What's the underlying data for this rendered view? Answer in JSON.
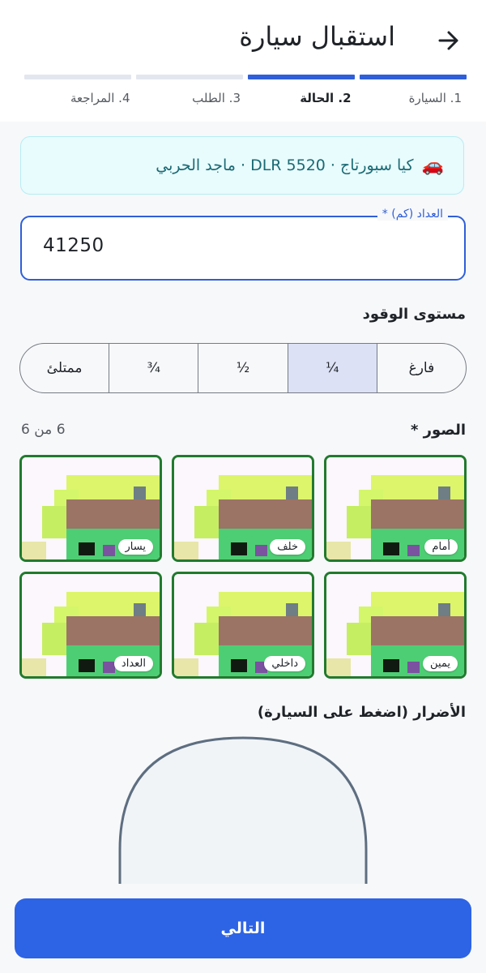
{
  "header": {
    "title": "استقبال سيارة",
    "back_icon": "arrow-right-icon"
  },
  "steps": [
    {
      "label": "1. السيارة",
      "state": "done",
      "color": "#2f5fd9"
    },
    {
      "label": "2. الحالة",
      "state": "current",
      "color": "#2f5fd9"
    },
    {
      "label": "3. الطلب",
      "state": "pending",
      "color": "#e3e6ee"
    },
    {
      "label": "4. المراجعة",
      "state": "pending",
      "color": "#e3e6ee"
    }
  ],
  "car_card": {
    "icon": "car-icon",
    "emoji": "🚗",
    "text": "كيا سبورتاج · DLR 5520 · ماجد الحربي"
  },
  "odometer": {
    "label": "العداد (كم) *",
    "value": "41250"
  },
  "fuel": {
    "label": "مستوى الوقود",
    "options": [
      "فارغ",
      "¼",
      "½",
      "¾",
      "ممتلئ"
    ],
    "selected": "¼"
  },
  "photos": {
    "label": "الصور *",
    "count": "6 من 6",
    "items": [
      {
        "tag": "أمام"
      },
      {
        "tag": "خلف"
      },
      {
        "tag": "يسار"
      },
      {
        "tag": "يمين"
      },
      {
        "tag": "داخلي"
      },
      {
        "tag": "العداد"
      }
    ]
  },
  "damage": {
    "label": "الأضرار (اضغط على السيارة)"
  },
  "footer": {
    "next_label": "التالي"
  },
  "colors": {
    "primary": "#2d63e5",
    "accent_border": "#2f5fd9",
    "photo_border": "#217a2e"
  }
}
